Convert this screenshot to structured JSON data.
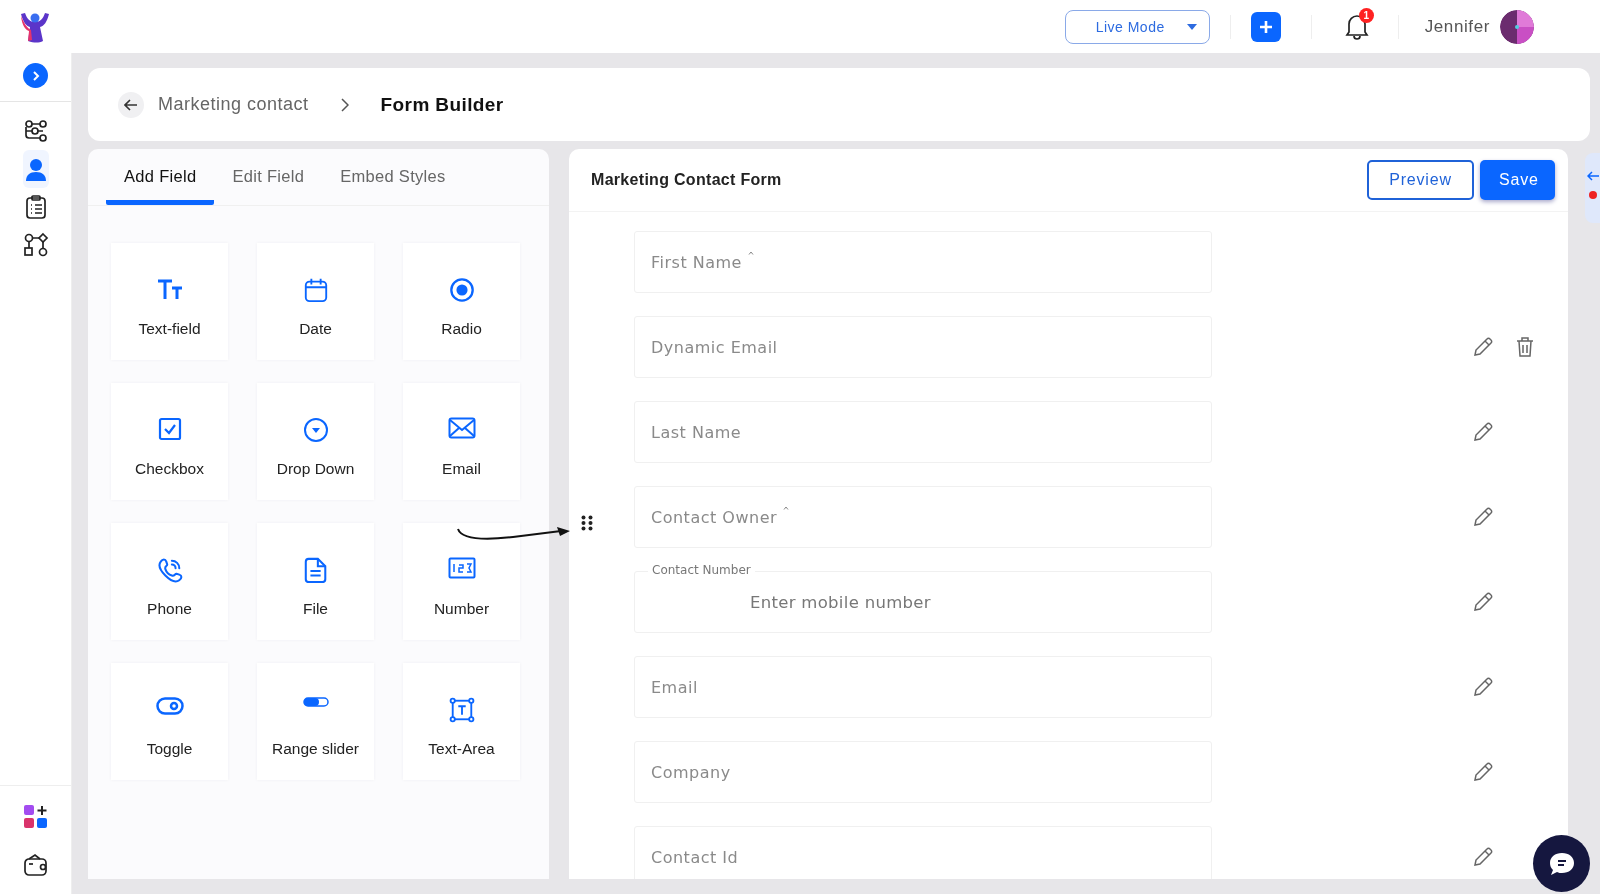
{
  "topbar": {
    "mode_selector": {
      "value": "Live Mode"
    },
    "notifications": {
      "count": "1"
    },
    "user": {
      "name": "Jennifer"
    }
  },
  "sidebar": {
    "items": [
      {
        "kind": "workflow",
        "selected": false
      },
      {
        "kind": "contacts",
        "selected": true
      },
      {
        "kind": "clipboard",
        "selected": false
      },
      {
        "kind": "flowchart",
        "selected": false
      }
    ],
    "bottom_items": [
      {
        "kind": "apps",
        "selected": false
      },
      {
        "kind": "wallet",
        "selected": false
      }
    ]
  },
  "breadcrumb": {
    "parent": "Marketing contact",
    "current": "Form Builder"
  },
  "tabs": [
    {
      "label": "Add Field",
      "selected": true
    },
    {
      "label": "Edit Field",
      "selected": false
    },
    {
      "label": "Embed Styles",
      "selected": false
    }
  ],
  "field_types": [
    {
      "label": "Text-field",
      "kind": "text"
    },
    {
      "label": "Date",
      "kind": "date"
    },
    {
      "label": "Radio",
      "kind": "radio"
    },
    {
      "label": "Checkbox",
      "kind": "checkbox"
    },
    {
      "label": "Drop Down",
      "kind": "dropdown"
    },
    {
      "label": "Email",
      "kind": "email"
    },
    {
      "label": "Phone",
      "kind": "phone"
    },
    {
      "label": "File",
      "kind": "file"
    },
    {
      "label": "Number",
      "kind": "number"
    },
    {
      "label": "Toggle",
      "kind": "toggle"
    },
    {
      "label": "Range slider",
      "kind": "slider"
    },
    {
      "label": "Text-Area",
      "kind": "textarea"
    }
  ],
  "form": {
    "title": "Marketing Contact Form",
    "buttons": [
      {
        "label": "Preview",
        "kind": "outline"
      },
      {
        "label": "Save",
        "kind": "primary"
      }
    ],
    "fields": [
      {
        "kind": "plain",
        "placeholder": "First Name",
        "required": true,
        "editable": false,
        "hovered": false
      },
      {
        "kind": "plain",
        "placeholder": "Dynamic Email",
        "required": false,
        "editable": true,
        "hovered": true
      },
      {
        "kind": "plain",
        "placeholder": "Last Name",
        "required": false,
        "editable": true,
        "hovered": false
      },
      {
        "kind": "plain",
        "placeholder": "Contact Owner",
        "required": true,
        "editable": true,
        "hovered": false
      },
      {
        "kind": "labeled",
        "label": "Contact Number",
        "placeholder": "Enter mobile number",
        "required": false,
        "editable": true,
        "hovered": false
      },
      {
        "kind": "plain",
        "placeholder": "Email",
        "required": false,
        "editable": true,
        "hovered": false
      },
      {
        "kind": "plain",
        "placeholder": "Company",
        "required": false,
        "editable": true,
        "hovered": false
      },
      {
        "kind": "plain",
        "placeholder": "Contact Id",
        "required": false,
        "editable": true,
        "hovered": false
      }
    ]
  }
}
